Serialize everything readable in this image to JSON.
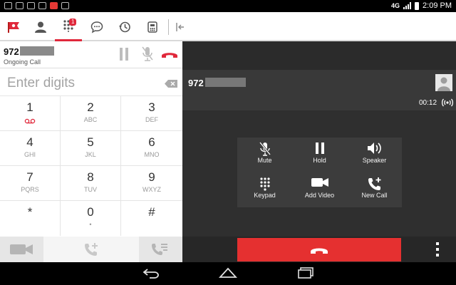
{
  "status_bar": {
    "network": "4G",
    "time": "2:09 PM"
  },
  "tabs": [
    {
      "icon": "flag-logo-icon"
    },
    {
      "icon": "contacts-icon"
    },
    {
      "icon": "dialpad-icon",
      "badge": "1",
      "active": true
    },
    {
      "icon": "chat-icon"
    },
    {
      "icon": "history-icon"
    },
    {
      "icon": "voicemail-box-icon"
    },
    {
      "icon": "collapse-panel-icon"
    }
  ],
  "ongoing_call": {
    "number_prefix": "972",
    "status": "Ongoing Call"
  },
  "dialer": {
    "placeholder": "Enter digits",
    "keys": [
      {
        "digit": "1",
        "sub": ""
      },
      {
        "digit": "2",
        "sub": "ABC"
      },
      {
        "digit": "3",
        "sub": "DEF"
      },
      {
        "digit": "4",
        "sub": "GHI"
      },
      {
        "digit": "5",
        "sub": "JKL"
      },
      {
        "digit": "6",
        "sub": "MNO"
      },
      {
        "digit": "7",
        "sub": "PQRS"
      },
      {
        "digit": "8",
        "sub": "TUV"
      },
      {
        "digit": "9",
        "sub": "WXYZ"
      },
      {
        "digit": "*",
        "sub": ""
      },
      {
        "digit": "0",
        "sub": "•"
      },
      {
        "digit": "#",
        "sub": ""
      }
    ]
  },
  "active_call": {
    "number_prefix": "972",
    "timer": "00:12",
    "controls": {
      "mute": "Mute",
      "hold": "Hold",
      "speaker": "Speaker",
      "keypad": "Keypad",
      "add_video": "Add Video",
      "new_call": "New Call"
    }
  },
  "colors": {
    "accent": "#e0283b",
    "end_call": "#e53030",
    "panel_dark": "#2f2f2f"
  }
}
